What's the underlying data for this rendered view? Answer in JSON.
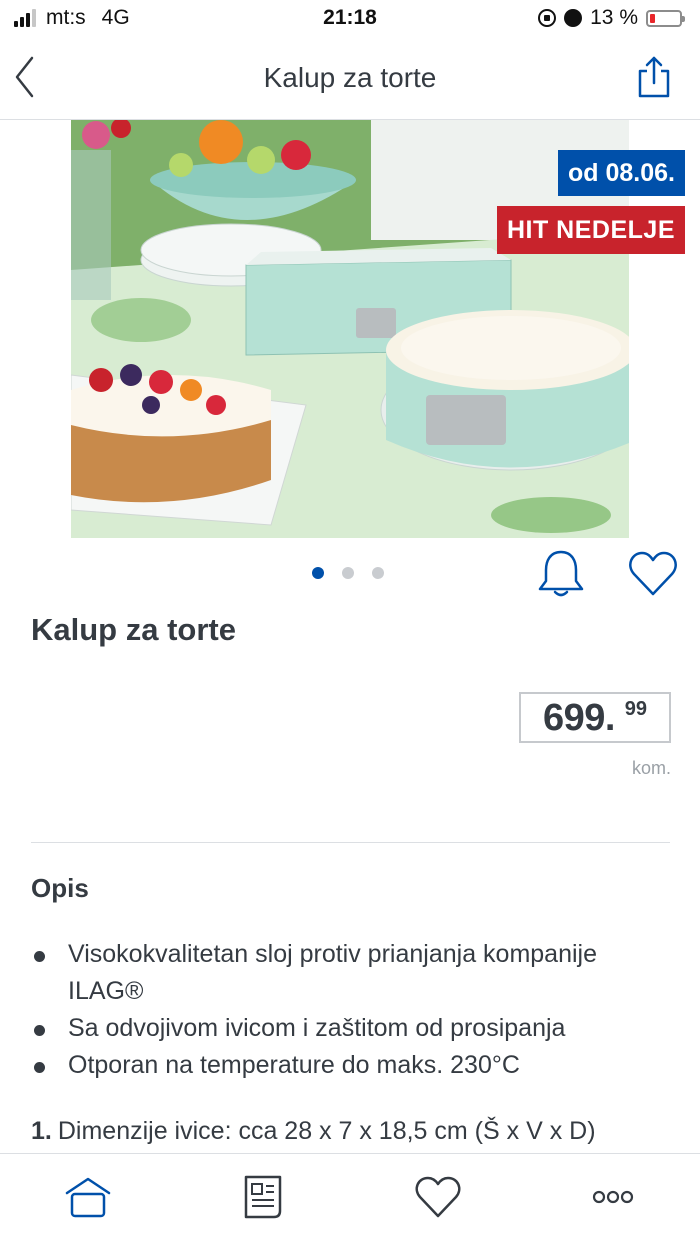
{
  "status_bar": {
    "carrier": "mt:s",
    "network": "4G",
    "time": "21:18",
    "battery_percent": "13 %",
    "battery_level": 0.13,
    "signal_bars_active": 3,
    "signal_bars_total": 4
  },
  "nav": {
    "title": "Kalup za torte",
    "back_icon": "chevron-left-icon",
    "share_icon": "share-icon"
  },
  "product": {
    "image_description_icon": "product-photo",
    "badge_date": "od 08.06.",
    "badge_hit": "HIT NEDELJE",
    "carousel": {
      "count": 3,
      "active_index": 0
    },
    "title": "Kalup za torte",
    "price_main": "699.",
    "price_cents": "99",
    "price_unit": "kom."
  },
  "description": {
    "heading": "Opis",
    "bullets": [
      "Visokokvalitetan sloj protiv prianjanja kompanije ILAG®",
      "Sa odvojivom ivicom i zaštitom od prosipanja",
      "Otporan na temperature do maks. 230°C"
    ],
    "dimension_num": "1.",
    "dimension_text": "Dimenzije ivice: cca 28 x 7 x 18,5 cm (Š x V x D)"
  },
  "tabbar": {
    "items": [
      {
        "icon": "home-icon"
      },
      {
        "icon": "leaflet-icon"
      },
      {
        "icon": "heart-icon"
      },
      {
        "icon": "more-icon"
      }
    ]
  },
  "colors": {
    "brand_blue": "#0050aa",
    "hit_red": "#c8232c",
    "text": "#353b42"
  }
}
